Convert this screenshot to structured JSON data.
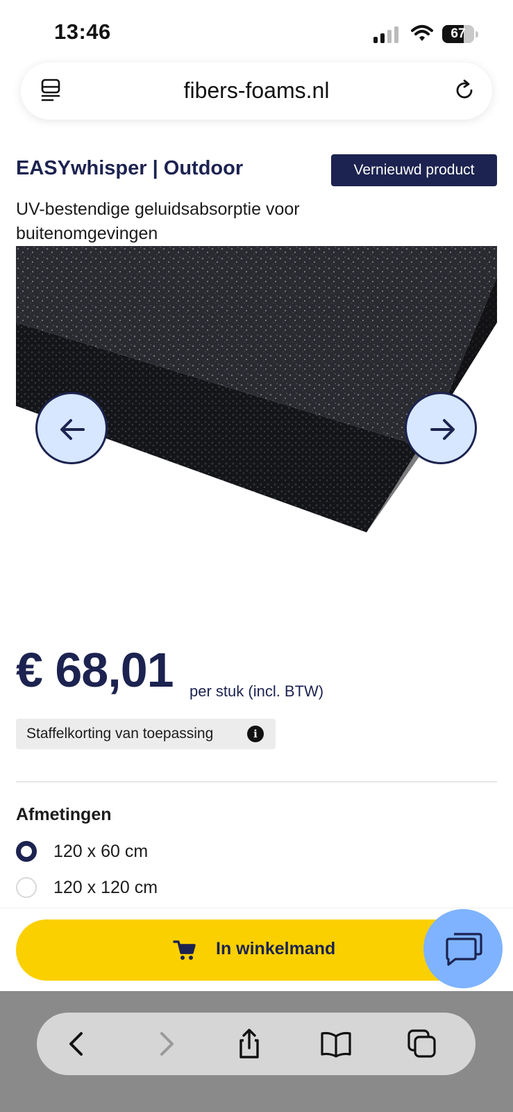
{
  "status_bar": {
    "time": "13:46",
    "battery": "67",
    "battery_fraction": 0.67
  },
  "browser": {
    "url": "fibers-foams.nl"
  },
  "product": {
    "title": "EASYwhisper | Outdoor",
    "badge": "Vernieuwd product",
    "subtitle": "UV-bestendige geluidsabsorptie voor buitenomgevingen"
  },
  "pricing": {
    "price": "€ 68,01",
    "note": "per stuk (incl. BTW)",
    "tier_discount": "Staffelkorting van toepassing"
  },
  "dimensions": {
    "title": "Afmetingen",
    "options": [
      {
        "label": "120 x 60 cm",
        "selected": true
      },
      {
        "label": "120 x 120 cm",
        "selected": false
      }
    ]
  },
  "cart": {
    "label": "In winkelmand"
  },
  "colors": {
    "navy": "#1c2350",
    "yellow": "#fbd000",
    "light_blue": "#d7e7ff",
    "chat_blue": "#7fb3ff"
  }
}
